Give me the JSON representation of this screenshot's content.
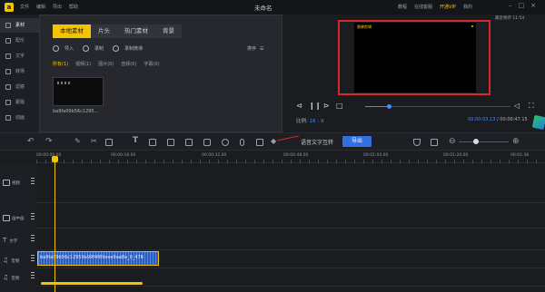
{
  "titlebar": {
    "logo": "a",
    "menu": [
      "文件",
      "编辑",
      "导出",
      "帮助"
    ],
    "project_title": "未命名",
    "right_menu": [
      "教程",
      "在线客服",
      "开通VIP",
      "我的"
    ]
  },
  "left_nav": {
    "items": [
      {
        "label": "素材",
        "active": true
      },
      {
        "label": "配乐"
      },
      {
        "label": "文字"
      },
      {
        "label": "转场"
      },
      {
        "label": "滤镜"
      },
      {
        "label": "蒙版"
      },
      {
        "label": "动画"
      }
    ]
  },
  "media": {
    "tabs": [
      "本地素材",
      "片头",
      "热门素材",
      "背景"
    ],
    "import_label": "导入",
    "record_label": "录制",
    "record_mic_label": "录制微课",
    "sort_label": "排序",
    "filters": [
      "所有(1)",
      "视频(1)",
      "图片(0)",
      "音频(0)",
      "字幕(0)"
    ],
    "thumb_name": "ba9fa09b56c1295..."
  },
  "preview": {
    "save_status": "最近保存 11:54",
    "watermark": "蜜蜂剪辑",
    "progress_fraction": 0.16,
    "ratio_label": "比例:",
    "ratio_value": "16 : 9",
    "current_time": "00:00:03.13",
    "total_time": "/ 00:00:47.15"
  },
  "toolbar": {
    "voice_to_text": "语音文字互转",
    "export_label": "导出",
    "zoom_fraction": 0.35
  },
  "ruler": {
    "labels": [
      "00:00:00.00",
      "00:00:16.00",
      "00:00:32.00",
      "00:00:48.00",
      "00:01:04.00",
      "00:01:20.00",
      "00:01:36"
    ]
  },
  "tracks": [
    {
      "label": "视频"
    },
    {
      "label": "画中画"
    },
    {
      "label": "文字"
    },
    {
      "label": "音频"
    },
    {
      "label": "音频"
    }
  ],
  "clip": {
    "name": "ba9fa09b56c12959a99f4f89eee9aa8a_0_476"
  },
  "colors": {
    "accent": "#f5c400",
    "highlight_border": "#d42a2a",
    "primary_blue": "#2f6fe0"
  }
}
